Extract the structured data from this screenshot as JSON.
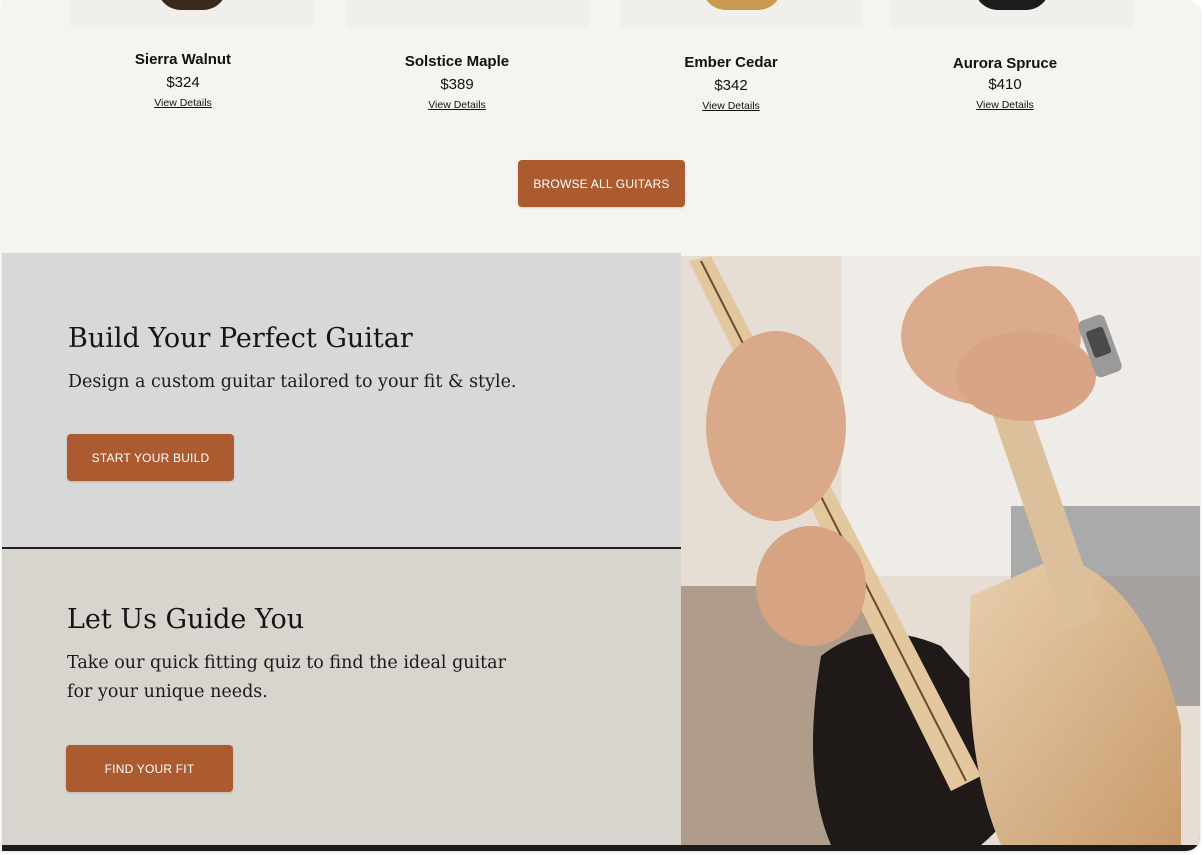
{
  "products": [
    {
      "name": "Sierra Walnut",
      "price": "$324",
      "link": "View Details"
    },
    {
      "name": "Solstice Maple",
      "price": "$389",
      "link": "View Details"
    },
    {
      "name": "Ember Cedar",
      "price": "$342",
      "link": "View Details"
    },
    {
      "name": "Aurora Spruce",
      "price": "$410",
      "link": "View Details"
    }
  ],
  "browse_button": "BROWSE ALL GUITARS",
  "build": {
    "title": "Build Your Perfect Guitar",
    "text": "Design a custom guitar tailored to your fit & style.",
    "button": "START YOUR BUILD"
  },
  "guide": {
    "title": "Let Us Guide You",
    "text_line1": "Take our quick fitting quiz to find the ideal guitar",
    "text_line2": "for your unique needs.",
    "button": "FIND YOUR FIT"
  },
  "colors": {
    "accent": "#ac5b31",
    "page_bg": "#f6f4f1",
    "build_bg": "#d8d8d8",
    "guide_bg": "#d8d4ce"
  }
}
